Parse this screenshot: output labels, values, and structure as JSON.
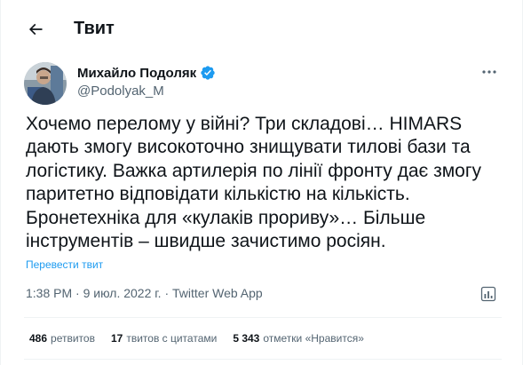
{
  "header": {
    "title": "Твит",
    "back_icon": "arrow-left-icon"
  },
  "author": {
    "name": "Михайло Подоляк",
    "handle": "@Podolyak_M",
    "verified_icon": "verified-badge-icon",
    "verified_color": "#1d9bf0"
  },
  "tweet": {
    "text": "Хочемо перелому у війні? Три складові… HIMARS\nдають змогу високоточно знищувати тилові бази та\nлогістику. Важка артилерія по лінії фронту дає змогу\nпаритетно відповідати кількістю на кількість.\nБронетехніка для «кулаків прориву»… Більше\nінструментів – швидше зачистимо росіян.",
    "translate_label": "Перевести твит",
    "time": "1:38 PM",
    "separator": "·",
    "date": "9 июл. 2022 г.",
    "source": "Twitter Web App"
  },
  "stats": {
    "retweets_count": "486",
    "retweets_label": "ретвитов",
    "quotes_count": "17",
    "quotes_label": "твитов с цитатами",
    "likes_count": "5 343",
    "likes_label": "отметки «Нравится»"
  },
  "colors": {
    "link": "#1d9bf0",
    "secondary_text": "#536471",
    "primary_text": "#0f1419",
    "border": "#eff3f4"
  }
}
